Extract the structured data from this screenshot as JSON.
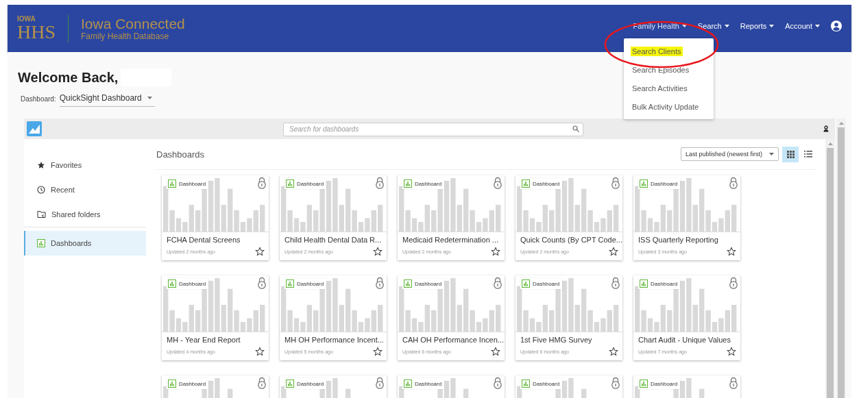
{
  "header": {
    "logo_top": "IOWA",
    "logo_main": "HHS",
    "title": "Iowa Connected",
    "subtitle": "Family Health Database",
    "nav": [
      {
        "label": "Family Health",
        "open": true
      },
      {
        "label": "Search",
        "open": false
      },
      {
        "label": "Reports",
        "open": false
      },
      {
        "label": "Account",
        "open": false
      }
    ]
  },
  "menu": {
    "items": [
      {
        "label": "Search Clients",
        "highlighted": true
      },
      {
        "label": "Search Episodes",
        "highlighted": false
      },
      {
        "label": "Search Activities",
        "highlighted": false
      },
      {
        "label": "Bulk Activity Update",
        "highlighted": false
      }
    ]
  },
  "welcome": {
    "heading": "Welcome Back,"
  },
  "dashboard_picker": {
    "label": "Dashboard:",
    "value": "QuickSight Dashboard"
  },
  "quicksight": {
    "search": {
      "placeholder": "Search for dashboards"
    },
    "sidebar": [
      {
        "label": "Favorites",
        "selected": false
      },
      {
        "label": "Recent",
        "selected": false
      },
      {
        "label": "Shared folders",
        "selected": false
      },
      {
        "label": "Dashboards",
        "selected": true
      }
    ],
    "heading": "Dashboards",
    "sort": "Last published (newest first)",
    "views": [
      {
        "kind": "grid",
        "selected": true
      },
      {
        "kind": "list",
        "selected": false
      }
    ],
    "cards": [
      {
        "badge": "Dashboard",
        "title": "FCHA Dental Screens",
        "updated": "Updated 2 months ago"
      },
      {
        "badge": "Dashboard",
        "title": "Child Health Dental Data R...",
        "updated": "Updated 2 months ago"
      },
      {
        "badge": "Dashboard",
        "title": "Medicaid Redetermination ...",
        "updated": "Updated 2 months ago"
      },
      {
        "badge": "Dashboard",
        "title": "Quick Counts (By CPT Code...",
        "updated": "Updated 2 months ago"
      },
      {
        "badge": "Dashboard",
        "title": "ISS Quarterly Reporting",
        "updated": "Updated 3 months ago"
      },
      {
        "badge": "Dashboard",
        "title": "MH - Year End Report",
        "updated": "Updated 4 months ago"
      },
      {
        "badge": "Dashboard",
        "title": "MH OH Performance Incent...",
        "updated": "Updated 5 months ago"
      },
      {
        "badge": "Dashboard",
        "title": "CAH OH Performance Incen...",
        "updated": "Updated 6 months ago"
      },
      {
        "badge": "Dashboard",
        "title": "1st Five HMG Survey",
        "updated": "Updated 6 months ago"
      },
      {
        "badge": "Dashboard",
        "title": "Chart Audit - Unique Values",
        "updated": "Updated 7 months ago"
      },
      {
        "badge": "Dashboard"
      },
      {
        "badge": "Dashboard"
      },
      {
        "badge": "Dashboard"
      },
      {
        "badge": "Dashboard"
      },
      {
        "badge": "Dashboard"
      }
    ]
  }
}
